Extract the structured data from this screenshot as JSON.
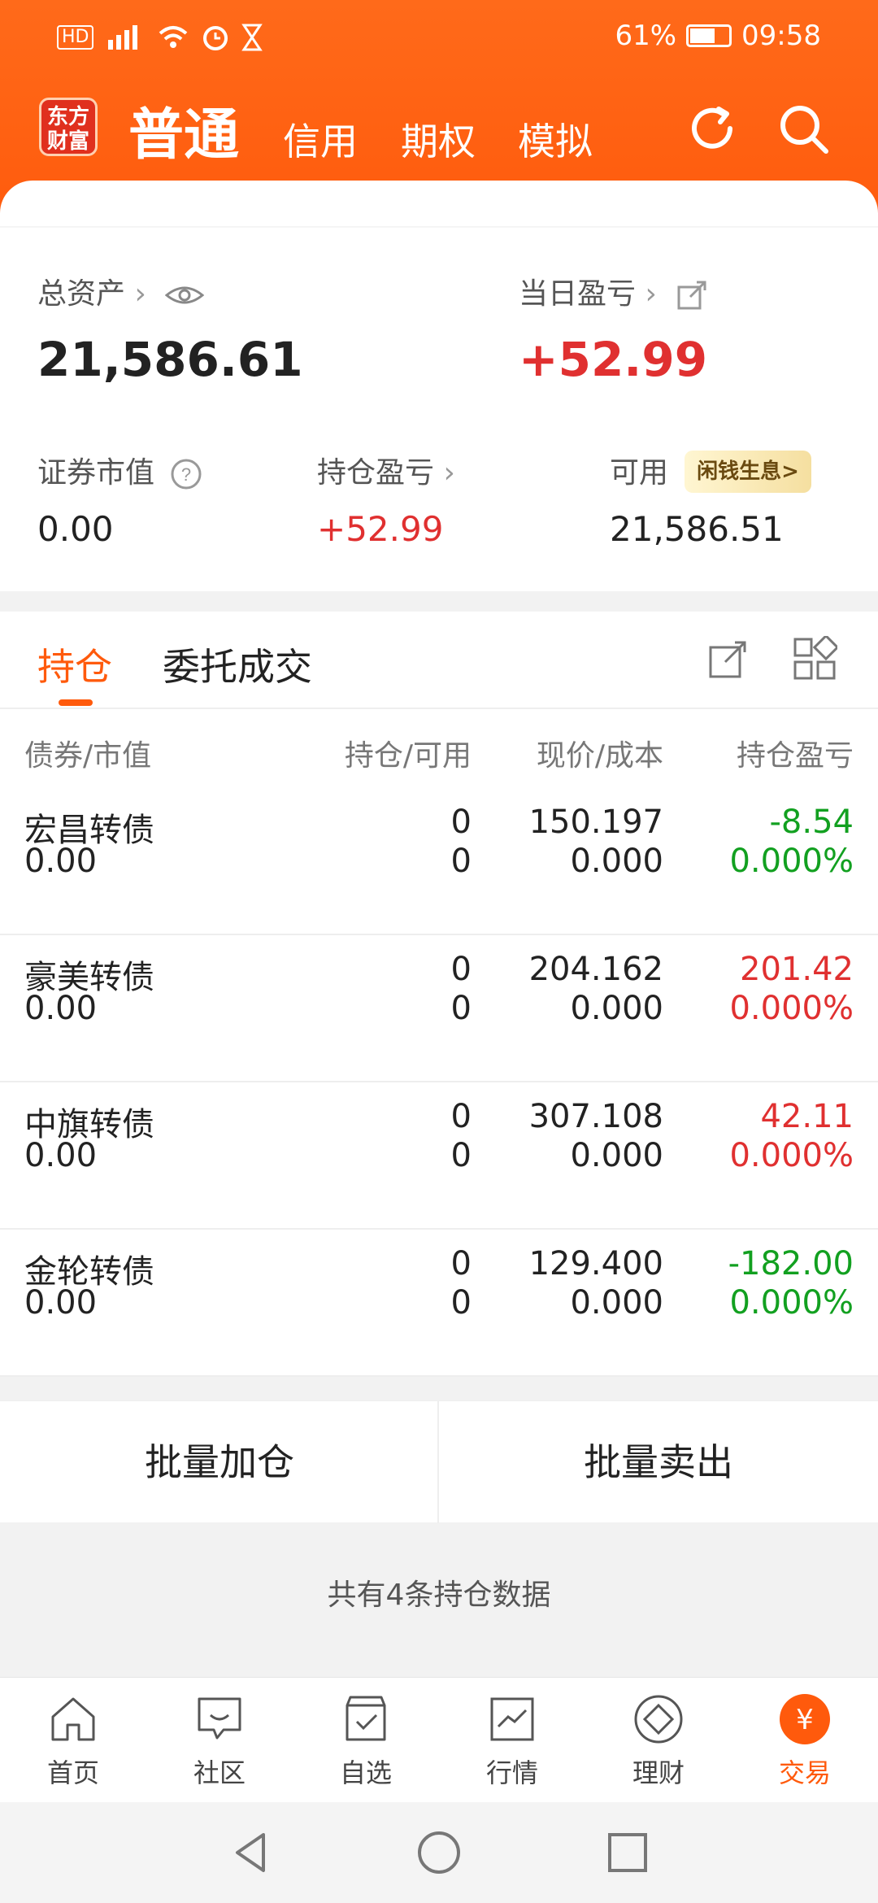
{
  "status": {
    "left_icons": "HD 4G signal wifi alarm hourglass",
    "battery_pct": "61%",
    "time": "09:58"
  },
  "topnav": {
    "logo": "东方\n财富",
    "tabs": [
      "普通",
      "信用",
      "期权",
      "模拟"
    ]
  },
  "summary": {
    "total_assets_label": "总资产",
    "total_assets_value": "21,586.61",
    "daily_pnl_label": "当日盈亏",
    "daily_pnl_value": "+52.99",
    "securities_value_label": "证券市值",
    "securities_value_value": "0.00",
    "position_pnl_label": "持仓盈亏",
    "position_pnl_value": "+52.99",
    "available_label": "可用",
    "available_chip": "闲钱生息>",
    "available_value": "21,586.51"
  },
  "tabs": {
    "active": "持仓",
    "other": "委托成交"
  },
  "table": {
    "headers": [
      "债券/市值",
      "持仓/可用",
      "现价/成本",
      "持仓盈亏"
    ],
    "rows": [
      {
        "name": "宏昌转债",
        "mv": "0.00",
        "pos": "0",
        "avail": "0",
        "price": "150.197",
        "cost": "0.000",
        "pnl": "-8.54",
        "pct": "0.000%",
        "pnl_color": "#12a020",
        "pct_color": "#12a020"
      },
      {
        "name": "豪美转债",
        "mv": "0.00",
        "pos": "0",
        "avail": "0",
        "price": "204.162",
        "cost": "0.000",
        "pnl": "201.42",
        "pct": "0.000%",
        "pnl_color": "#e03030",
        "pct_color": "#e03030"
      },
      {
        "name": "中旗转债",
        "mv": "0.00",
        "pos": "0",
        "avail": "0",
        "price": "307.108",
        "cost": "0.000",
        "pnl": "42.11",
        "pct": "0.000%",
        "pnl_color": "#e03030",
        "pct_color": "#e03030"
      },
      {
        "name": "金轮转债",
        "mv": "0.00",
        "pos": "0",
        "avail": "0",
        "price": "129.400",
        "cost": "0.000",
        "pnl": "-182.00",
        "pct": "0.000%",
        "pnl_color": "#12a020",
        "pct_color": "#12a020"
      }
    ]
  },
  "actions": {
    "batch_add": "批量加仓",
    "batch_sell": "批量卖出"
  },
  "footer": {
    "count_text": "共有4条持仓数据"
  },
  "bottomnav": {
    "items": [
      {
        "label": "首页",
        "icon": "home-icon"
      },
      {
        "label": "社区",
        "icon": "community-icon"
      },
      {
        "label": "自选",
        "icon": "watchlist-icon"
      },
      {
        "label": "行情",
        "icon": "market-icon"
      },
      {
        "label": "理财",
        "icon": "finance-icon"
      },
      {
        "label": "交易",
        "icon": "trade-icon"
      }
    ]
  },
  "colors": {
    "accent": "#ff5a0c",
    "up": "#e03030",
    "down": "#12a020"
  }
}
